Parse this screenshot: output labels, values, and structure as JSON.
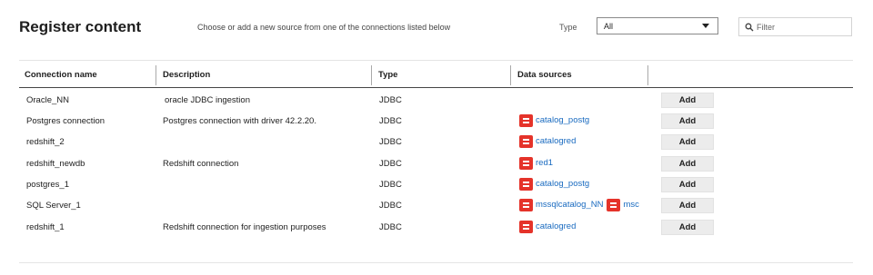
{
  "page": {
    "title": "Register content",
    "subtitle": "Choose or add a new source from one of the connections listed below"
  },
  "type_filter": {
    "label": "Type",
    "selected": "All"
  },
  "filter": {
    "placeholder": "Filter"
  },
  "table": {
    "headers": [
      "Connection name",
      "Description",
      "Type",
      "Data sources"
    ],
    "rows": [
      {
        "name": "Oracle_NN",
        "description": "oracle JDBC ingestion",
        "type": "JDBC",
        "sources": [],
        "action": "Add"
      },
      {
        "name": "Postgres connection",
        "description": "Postgres connection with driver 42.2.20.",
        "type": "JDBC",
        "sources": [
          "catalog_postg"
        ],
        "action": "Add"
      },
      {
        "name": "redshift_2",
        "description": "",
        "type": "JDBC",
        "sources": [
          "catalogred"
        ],
        "action": "Add"
      },
      {
        "name": "redshift_newdb",
        "description": "Redshift connection",
        "type": "JDBC",
        "sources": [
          "red1"
        ],
        "action": "Add"
      },
      {
        "name": "postgres_1",
        "description": "",
        "type": "JDBC",
        "sources": [
          "catalog_postg"
        ],
        "action": "Add"
      },
      {
        "name": "SQL Server_1",
        "description": "",
        "type": "JDBC",
        "sources": [
          "mssqlcatalog_NN",
          "msc"
        ],
        "action": "Add"
      },
      {
        "name": "redshift_1",
        "description": "Redshift connection for ingestion purposes",
        "type": "JDBC",
        "sources": [
          "catalogred"
        ],
        "action": "Add"
      }
    ]
  },
  "icons": {
    "source": "database-icon",
    "filter": "search-icon",
    "dropdown": "chevron-down-icon"
  },
  "colors": {
    "source_icon": "#e5332a",
    "link": "#1a6bc0",
    "button_bg": "#ececec"
  }
}
